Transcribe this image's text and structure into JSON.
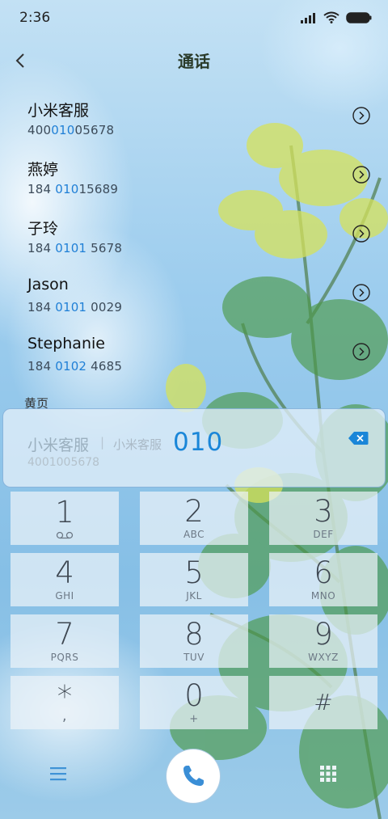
{
  "status_bar": {
    "time": "2:36"
  },
  "header": {
    "title": "通话"
  },
  "contacts": [
    {
      "name": "小米客服",
      "num_pre": "400",
      "num_hl": "010",
      "num_post": "05678"
    },
    {
      "name": "燕婷",
      "num_pre": "184 ",
      "num_hl": "010",
      "num_post": "15689"
    },
    {
      "name": "子玲",
      "num_pre": "184 ",
      "num_hl": "0101",
      "num_post": " 5678"
    },
    {
      "name": "Jason",
      "num_pre": "184 ",
      "num_hl": "0101",
      "num_post": " 0029"
    },
    {
      "name": "Stephanie",
      "num_pre": "184 ",
      "num_hl": "0102",
      "num_post": " 4685"
    }
  ],
  "section_label": "黄页",
  "search": {
    "match_name": "小米客服",
    "separator": "|",
    "match_source": "小米客服",
    "input": "010",
    "match_number": "4001005678"
  },
  "keypad": [
    {
      "digit": "1",
      "letters": ""
    },
    {
      "digit": "2",
      "letters": "ABC"
    },
    {
      "digit": "3",
      "letters": "DEF"
    },
    {
      "digit": "4",
      "letters": "GHI"
    },
    {
      "digit": "5",
      "letters": "JKL"
    },
    {
      "digit": "6",
      "letters": "MNO"
    },
    {
      "digit": "7",
      "letters": "PQRS"
    },
    {
      "digit": "8",
      "letters": "TUV"
    },
    {
      "digit": "9",
      "letters": "WXYZ"
    },
    {
      "digit": "*",
      "letters": ","
    },
    {
      "digit": "0",
      "letters": "+"
    },
    {
      "digit": "#",
      "letters": ""
    }
  ],
  "colors": {
    "accent": "#1a86d8",
    "highlight": "#1f7fd6",
    "title": "#2a3b2a"
  },
  "icons": {
    "back": "chevron-left-icon",
    "go": "chevron-right-circle-icon",
    "delete": "backspace-icon",
    "voicemail": "voicemail-icon",
    "menu": "menu-icon",
    "call": "phone-icon",
    "dialpad": "dialpad-icon"
  }
}
